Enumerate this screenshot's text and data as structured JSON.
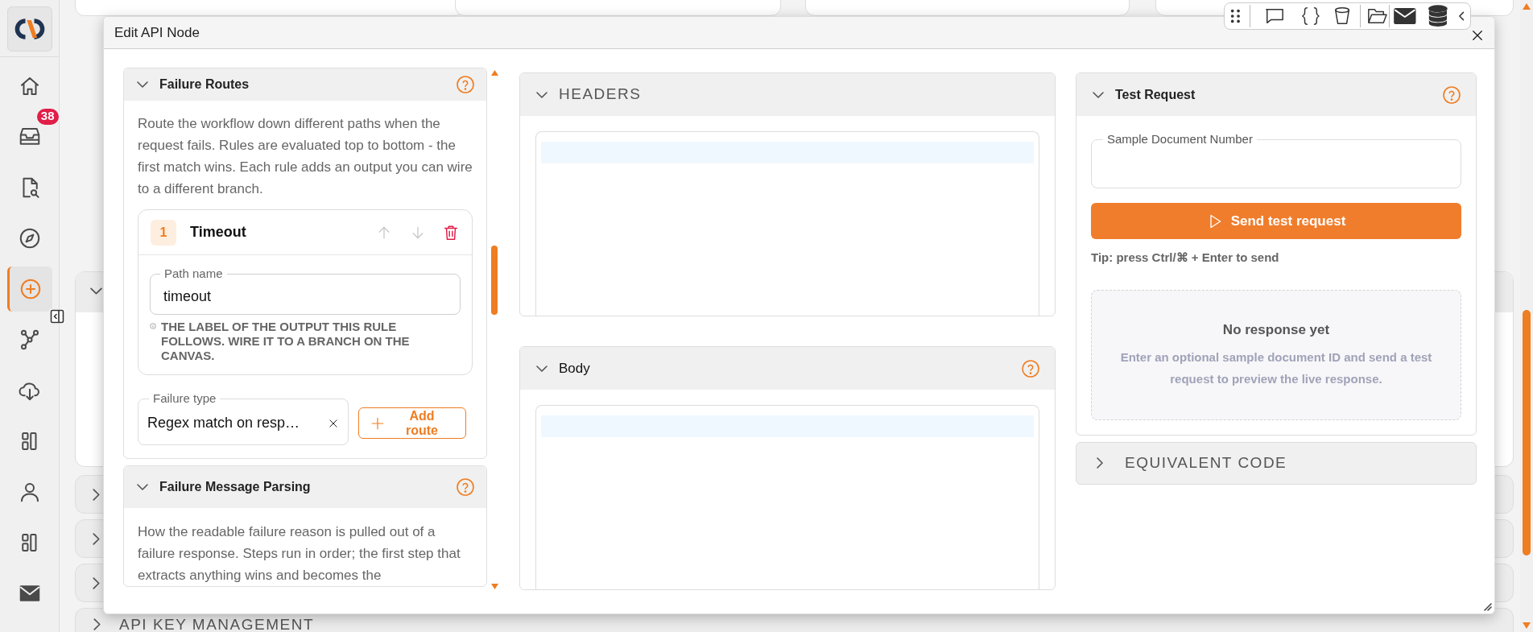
{
  "sidebar": {
    "items": [
      {
        "selected": false
      },
      {
        "selected": false,
        "badge": "38"
      },
      {
        "selected": false
      },
      {
        "selected": false
      },
      {
        "selected": true
      },
      {
        "selected": false
      },
      {
        "selected": false
      },
      {
        "selected": false
      },
      {
        "selected": false
      },
      {
        "selected": false
      },
      {
        "selected": false
      }
    ]
  },
  "background_panel": {
    "section_title": "API KEY MANAGEMENT"
  },
  "dialog": {
    "title": "Edit API Node",
    "failure_routes": {
      "title": "Failure Routes",
      "expanded": true,
      "description": "Route the workflow down different paths when the request fails. Rules are evaluated top to bottom - the first match wins. Each rule adds an output you can wire to a different branch.",
      "routes": [
        {
          "number": "1",
          "name": "Timeout",
          "move_up_disabled": true,
          "move_down_disabled": true,
          "path_name_label": "Path name",
          "path_name": "timeout",
          "hint": "THE LABEL OF THE OUTPUT THIS RULE FOLLOWS. WIRE IT TO A BRANCH ON THE CANVAS.",
          "failure_type_label": "Failure type",
          "failure_type": "Regex match on resp…"
        }
      ],
      "add_route": "Add route"
    },
    "failure_message_parsing": {
      "title": "Failure Message Parsing",
      "expanded": true,
      "description": "How the readable failure reason is pulled out of a failure response. Steps run in order; the first step that extracts anything wins and becomes the"
    },
    "headers": {
      "title": "HEADERS",
      "expanded": true
    },
    "body": {
      "title": "Body",
      "expanded": true
    },
    "test_request": {
      "title": "Test Request",
      "expanded": true,
      "field_label": "Sample Document Number",
      "send_button": "Send test request",
      "tip": "Tip: press Ctrl/⌘ + Enter to send",
      "empty_title": "No response yet",
      "empty_text": "Enter an optional sample document ID and send a test request to preview the live response."
    },
    "equivalent_code": {
      "title": "EQUIVALENT CODE",
      "expanded": false
    }
  }
}
